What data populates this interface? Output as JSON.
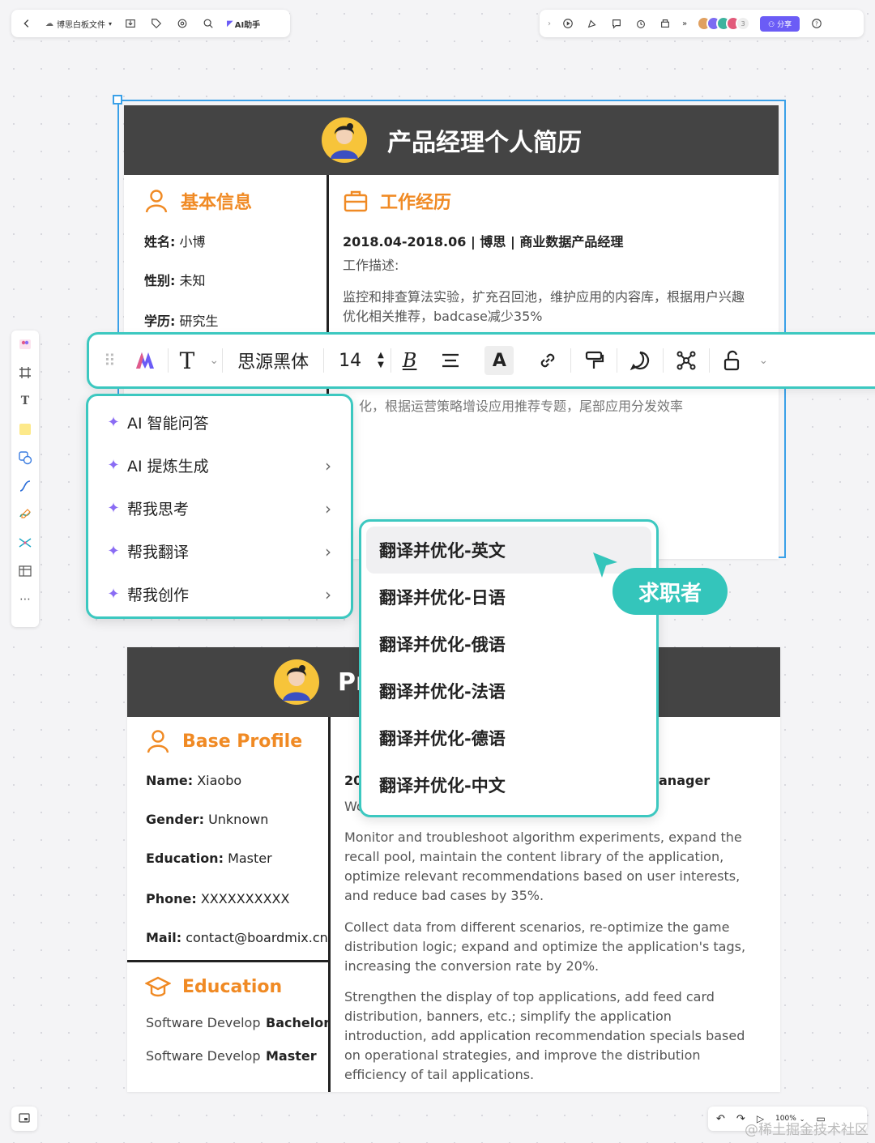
{
  "topbar": {
    "file_name": "博思白板文件",
    "ai_label": "AI助手",
    "avatar_count": "3",
    "share_label": "分享"
  },
  "cn_resume": {
    "title": "产品经理个人简历",
    "basic_title": "基本信息",
    "fields": [
      {
        "label": "姓名:",
        "value": "小博"
      },
      {
        "label": "性别:",
        "value": "未知"
      },
      {
        "label": "学历:",
        "value": "研究生"
      }
    ],
    "work_title": "工作经历",
    "job": "2018.04-2018.06 | 博思 | 商业数据产品经理",
    "desc_label": "工作描述:",
    "desc_1": "监控和排查算法实验，扩充召回池，维护应用的内容库，根据用户兴趣",
    "desc_2": "优化相关推荐，badcase减少35%",
    "desc_hidden": "化，根据运营策略增设应用推荐专题，尾部应用分发效率"
  },
  "toolbar": {
    "font_name": "思源黑体",
    "font_size": "14"
  },
  "ai_menu": {
    "items": [
      {
        "label": "AI 智能问答"
      },
      {
        "label": "AI 提炼生成"
      },
      {
        "label": "帮我思考"
      },
      {
        "label": "帮我翻译"
      },
      {
        "label": "帮我创作"
      }
    ]
  },
  "translate_menu": {
    "items": [
      {
        "label": "翻译并优化-英文"
      },
      {
        "label": "翻译并优化-日语"
      },
      {
        "label": "翻译并优化-俄语"
      },
      {
        "label": "翻译并优化-法语"
      },
      {
        "label": "翻译并优化-德语"
      },
      {
        "label": "翻译并优化-中文"
      }
    ]
  },
  "cursor_badge": "求职者",
  "en_resume": {
    "title_partial": "Pr",
    "profile_title": "Base Profile",
    "fields": [
      {
        "label": "Name:",
        "value": "Xiaobo"
      },
      {
        "label": "Gender:",
        "value": "Unknown"
      },
      {
        "label": "Education:",
        "value": "Master"
      },
      {
        "label": "Phone:",
        "value": "XXXXXXXXXX"
      },
      {
        "label": "Mail:",
        "value": "contact@boardmix.cn"
      }
    ],
    "edu_title": "Education",
    "edu_rows": [
      {
        "major": "Software Develop",
        "degree": "Bachelor"
      },
      {
        "major": "Software Develop",
        "degree": "Master"
      }
    ],
    "job_partial": "20",
    "job_tail": "anager",
    "desc_partial": "Wo",
    "para_1": "Monitor and troubleshoot algorithm experiments, expand the recall pool, maintain the content library of the application, optimize relevant recommendations based on user interests, and reduce bad cases by 35%.",
    "para_2": "Collect data from different scenarios, re-optimize the game distribution logic; expand and optimize the application's tags, increasing the conversion rate by 20%.",
    "para_3": "Strengthen the display of top applications, add feed card distribution, banners, etc.; simplify the application introduction, add application recommendation specials based on operational strategies, and improve the distribution efficiency of tail applications."
  },
  "footer": {
    "zoom": "100%"
  },
  "watermark": "@稀土掘金技术社区",
  "colors": {
    "accent_teal": "#3cc8c0",
    "section_orange": "#f08a24",
    "header_dark": "#444444",
    "share_purple": "#6b5cf6"
  }
}
